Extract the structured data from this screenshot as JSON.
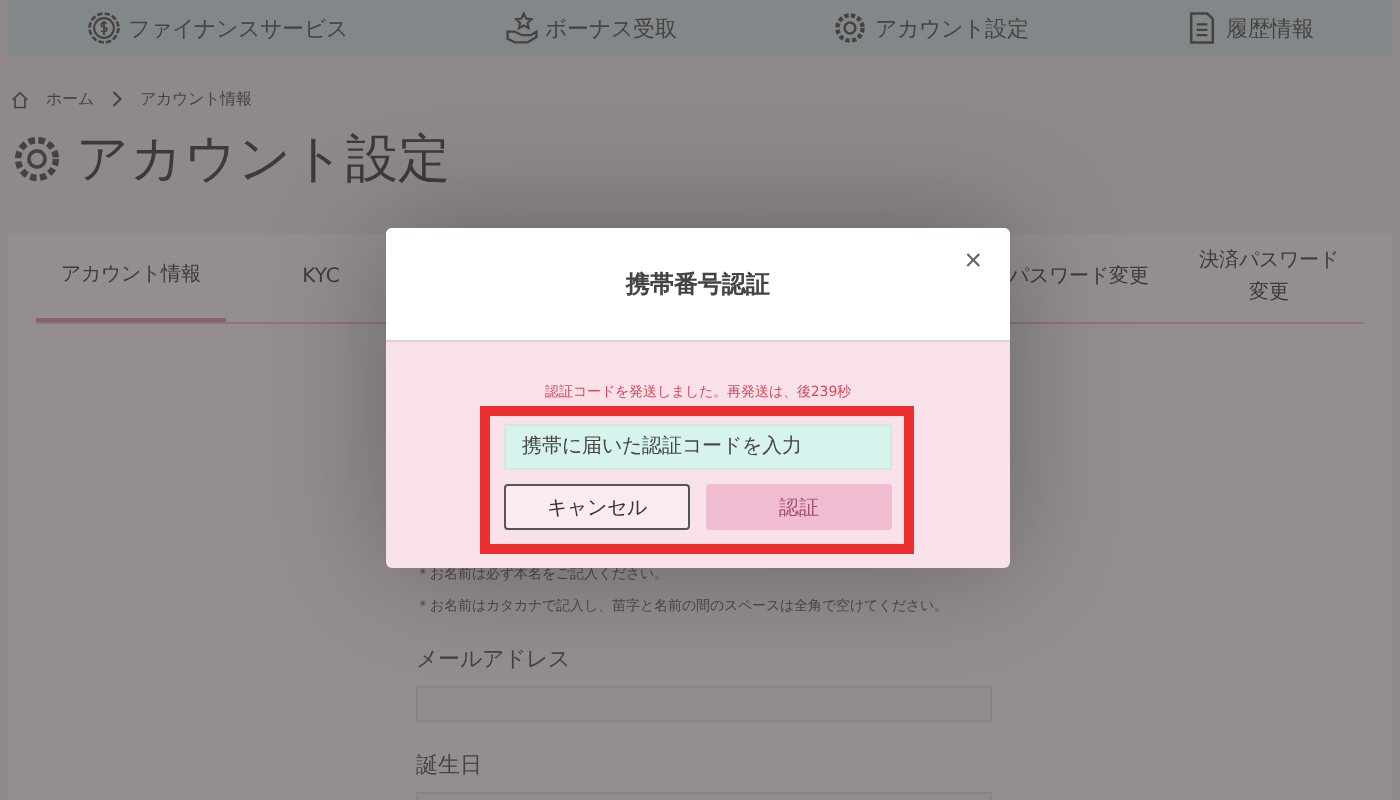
{
  "top_nav": {
    "items": [
      {
        "label": "ファイナンスサービス"
      },
      {
        "label": "ボーナス受取"
      },
      {
        "label": "アカウント設定"
      },
      {
        "label": "履歴情報"
      }
    ]
  },
  "breadcrumb": [
    "ホーム",
    "アカウント情報"
  ],
  "page_title": "アカウント設定",
  "tabs": [
    {
      "label": "アカウント情報",
      "selected": true
    },
    {
      "label": "KYC",
      "selected": false
    },
    {
      "label": "パスワード変更",
      "selected": false
    },
    {
      "label": "決済パスワード変更",
      "selected": false
    }
  ],
  "form": {
    "notes": [
      "＊お名前は必ず本名をご記入ください。",
      "＊お名前はカタカナで記入し、苗字と名前の間のスペースは全角で空けてください。"
    ],
    "fields": [
      {
        "label": "メールアドレス"
      },
      {
        "label": "誕生日"
      }
    ]
  },
  "modal": {
    "title": "携帯番号認証",
    "close": "×",
    "message": "認証コードを発送しました。再発送は、後239秒",
    "code_input": {
      "placeholder": "携帯に届いた認証コードを入力"
    },
    "buttons": [
      {
        "label": "キャンセル",
        "kind": "secondary",
        "disabled": false
      },
      {
        "label": "認証",
        "kind": "primary",
        "disabled": true
      }
    ]
  }
}
